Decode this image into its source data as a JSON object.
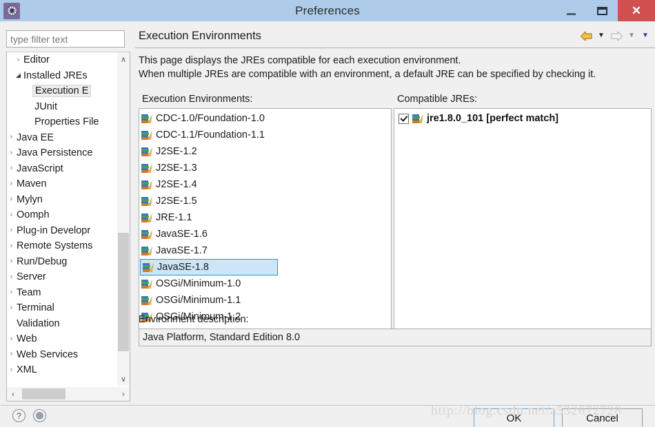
{
  "window": {
    "title": "Preferences",
    "icon": "gear-icon",
    "controls": {
      "minimize": "—",
      "maximize": "❑",
      "close": "✕"
    }
  },
  "sidebar": {
    "filter": {
      "placeholder": "type filter text",
      "value": ""
    },
    "tree": [
      {
        "label": "Editor",
        "depth": 1,
        "state": "collapsed"
      },
      {
        "label": "Installed JREs",
        "depth": 1,
        "state": "expanded"
      },
      {
        "label": "Execution E",
        "depth": 2,
        "state": "leaf",
        "selected": true
      },
      {
        "label": "JUnit",
        "depth": 2,
        "state": "leaf"
      },
      {
        "label": "Properties File",
        "depth": 2,
        "state": "leaf"
      },
      {
        "label": "Java EE",
        "depth": 0,
        "state": "collapsed"
      },
      {
        "label": "Java Persistence",
        "depth": 0,
        "state": "collapsed"
      },
      {
        "label": "JavaScript",
        "depth": 0,
        "state": "collapsed"
      },
      {
        "label": "Maven",
        "depth": 0,
        "state": "collapsed"
      },
      {
        "label": "Mylyn",
        "depth": 0,
        "state": "collapsed"
      },
      {
        "label": "Oomph",
        "depth": 0,
        "state": "collapsed"
      },
      {
        "label": "Plug-in Developr",
        "depth": 0,
        "state": "collapsed"
      },
      {
        "label": "Remote Systems",
        "depth": 0,
        "state": "collapsed"
      },
      {
        "label": "Run/Debug",
        "depth": 0,
        "state": "collapsed"
      },
      {
        "label": "Server",
        "depth": 0,
        "state": "collapsed"
      },
      {
        "label": "Team",
        "depth": 0,
        "state": "collapsed"
      },
      {
        "label": "Terminal",
        "depth": 0,
        "state": "collapsed"
      },
      {
        "label": "Validation",
        "depth": 0,
        "state": "leaf"
      },
      {
        "label": "Web",
        "depth": 0,
        "state": "collapsed"
      },
      {
        "label": "Web Services",
        "depth": 0,
        "state": "collapsed"
      },
      {
        "label": "XML",
        "depth": 0,
        "state": "collapsed"
      }
    ],
    "scroll": {
      "up_glyph": "∧",
      "down_glyph": "∨",
      "left_glyph": "‹",
      "right_glyph": "›"
    }
  },
  "page": {
    "title": "Execution Environments",
    "description_line1": "This page displays the JREs compatible for each execution environment.",
    "description_line2": "When multiple JREs are compatible with an environment, a default JRE can be specified by checking it.",
    "nav": {
      "back": "back-arrow",
      "back_menu": "▼",
      "forward": "forward-arrow",
      "forward_menu": "▼",
      "view_menu": "▼"
    },
    "environments_label": "Execution Environments:",
    "environments": [
      {
        "name": "CDC-1.0/Foundation-1.0",
        "selected": false
      },
      {
        "name": "CDC-1.1/Foundation-1.1",
        "selected": false
      },
      {
        "name": "J2SE-1.2",
        "selected": false
      },
      {
        "name": "J2SE-1.3",
        "selected": false
      },
      {
        "name": "J2SE-1.4",
        "selected": false
      },
      {
        "name": "J2SE-1.5",
        "selected": false
      },
      {
        "name": "JRE-1.1",
        "selected": false
      },
      {
        "name": "JavaSE-1.6",
        "selected": false
      },
      {
        "name": "JavaSE-1.7",
        "selected": false
      },
      {
        "name": "JavaSE-1.8",
        "selected": true
      },
      {
        "name": "OSGi/Minimum-1.0",
        "selected": false
      },
      {
        "name": "OSGi/Minimum-1.1",
        "selected": false
      },
      {
        "name": "OSGi/Minimum-1.2",
        "selected": false
      }
    ],
    "compatible_label": "Compatible JREs:",
    "compatible_jres": [
      {
        "name": "jre1.8.0_101 [perfect match]",
        "checked": true
      }
    ],
    "env_description_label": "Environment description:",
    "env_description_value": "Java Platform, Standard Edition 8.0"
  },
  "footer": {
    "help_icon": "?",
    "apply_icon": "restore-defaults-icon",
    "ok_label": "OK",
    "cancel_label": "Cancel"
  },
  "watermark": "http://blog.csdn.net/a532672728",
  "colors": {
    "titlebar": "#aeccea",
    "close_button": "#d04f4f",
    "selection": "#cde6f7",
    "selection_border": "#2d8fd0",
    "focus_border": "#5fa2dd",
    "panel_bg": "#f0f0f0"
  }
}
